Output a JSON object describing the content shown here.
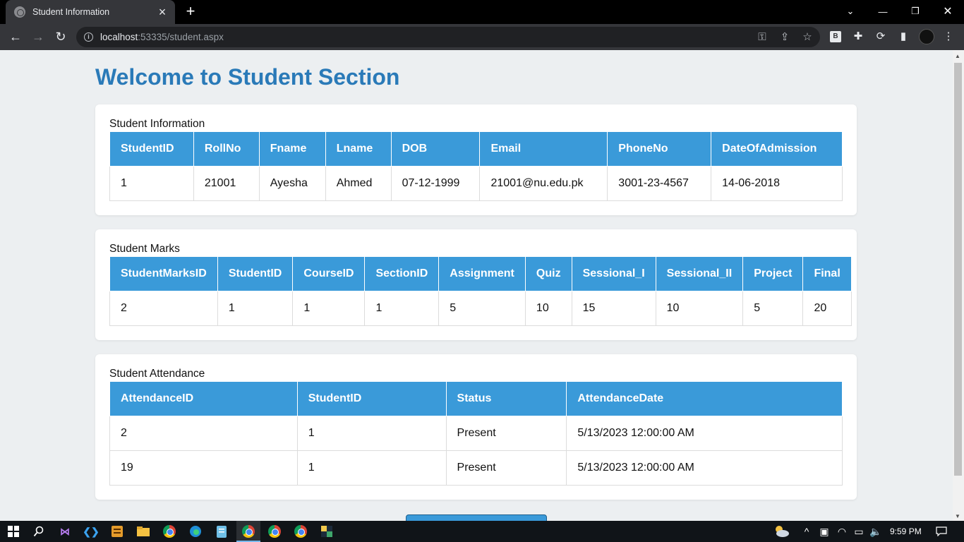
{
  "browser": {
    "tab_title": "Student Information",
    "url_host": "localhost",
    "url_rest": ":53335/student.aspx"
  },
  "page": {
    "heading": "Welcome to Student Section"
  },
  "student_info": {
    "caption": "Student Information",
    "headers": [
      "StudentID",
      "RollNo",
      "Fname",
      "Lname",
      "DOB",
      "Email",
      "PhoneNo",
      "DateOfAdmission"
    ],
    "rows": [
      [
        "1",
        "21001",
        "Ayesha",
        "Ahmed",
        "07-12-1999",
        "21001@nu.edu.pk",
        "3001-23-4567",
        "14-06-2018"
      ]
    ]
  },
  "student_marks": {
    "caption": "Student Marks",
    "headers": [
      "StudentMarksID",
      "StudentID",
      "CourseID",
      "SectionID",
      "Assignment",
      "Quiz",
      "Sessional_I",
      "Sessional_II",
      "Project",
      "Final"
    ],
    "rows": [
      [
        "2",
        "1",
        "1",
        "1",
        "5",
        "10",
        "15",
        "10",
        "5",
        "20"
      ]
    ]
  },
  "student_attendance": {
    "caption": "Student Attendance",
    "headers": [
      "AttendanceID",
      "StudentID",
      "Status",
      "AttendanceDate"
    ],
    "rows": [
      [
        "2",
        "1",
        "Present",
        "5/13/2023 12:00:00 AM"
      ],
      [
        "19",
        "1",
        "Present",
        "5/13/2023 12:00:00 AM"
      ]
    ]
  },
  "taskbar": {
    "clock": "9:59 PM"
  },
  "colors": {
    "heading": "#2a7ab8",
    "table_header": "#3a9ad9",
    "page_bg": "#eceff1"
  }
}
